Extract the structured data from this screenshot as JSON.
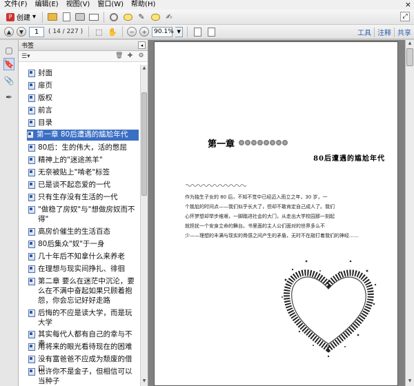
{
  "menu": {
    "items": [
      "文件(F)",
      "编辑(E)",
      "视图(V)",
      "窗口(W)",
      "帮助(H)"
    ],
    "close_glyph": "×"
  },
  "toolbar": {
    "create_label": "创建",
    "create_dropdown": "▾"
  },
  "nav": {
    "page_current": "1",
    "page_total": "( 14 / 227 )",
    "zoom_value": "90.1%",
    "zoom_out": "−",
    "zoom_in": "+"
  },
  "right_links": {
    "tools": "工具",
    "comment": "注释",
    "share": "共享"
  },
  "bookmarks_panel": {
    "title": "书签",
    "options_label": "☰▾",
    "items": [
      "封面",
      "扉页",
      "版权",
      "前言",
      "目录",
      "第一章 80后遭遇的尴尬年代",
      "80后：生的伟大，活的憋屈",
      "精神上的\"迷途羔羊\"",
      "无奈被贴上\"啃老\"标签",
      "已是谈不起恋爱的一代",
      "只有生存没有生活的一代",
      "\"做稳了房奴\"与\"想做房奴而不得\"",
      "高房价催生的生活百态",
      "80后集众\"奴\"于一身",
      "几十年后不知拿什么来养老",
      "在理想与现实间挣扎、徘徊",
      "第二章 要么在迷茫中沉沦，要么在不满中奋起如果只顾着抱怨，你会忘记好好走路",
      "后悔的不应是读大学，而是玩大学",
      "其实每代人都有自己的幸与不幸",
      "用将来的眼光看待现在的困难",
      "没有富爸爸不应成为颓废的借口",
      "也许你不是金子，但相信可以当种子"
    ],
    "selected_index": 5
  },
  "document": {
    "chapter_title": "第一章",
    "chapter_subtitle": "80后遭遇的尴尬年代",
    "paragraph_lines": [
      "作为独生子女的 80 后，不知不觉中已经迈入而立之年，30 岁，一",
      "个尴尬的时间点——我们似乎长大了，但却不敢肯定自己成人了。我们",
      "心怀梦想却举步维艰，一脚踏进社会的大门，从走出大学校园那一刻起",
      "就担扰一个安身立命的舞台。书里面的主人公们面对的世界多么不",
      "少——理想的丰满与现实的骨感之间产生的矛盾，无时不在敲打着我们的神经……"
    ]
  },
  "colors": {
    "selection": "#3b6fc4",
    "link": "#2a5fa8"
  }
}
